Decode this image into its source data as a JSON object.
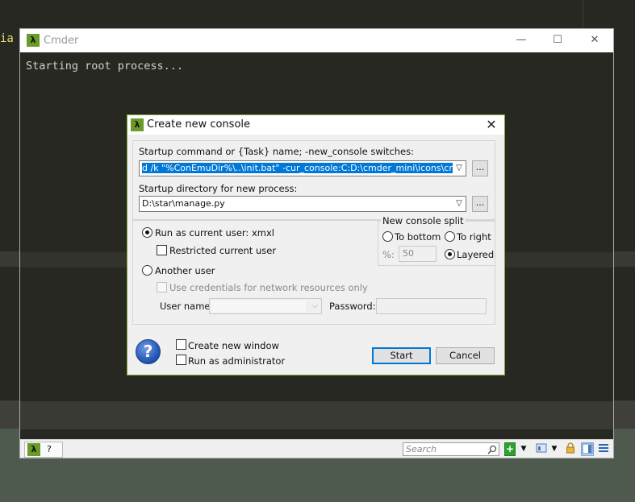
{
  "background": {
    "code_fragment": "ia"
  },
  "window": {
    "title": "Cmder",
    "minimize_glyph": "—",
    "maximize_glyph": "☐",
    "close_glyph": "✕"
  },
  "console": {
    "output": "Starting root process..."
  },
  "statusbar": {
    "tab_label": "?",
    "search_placeholder": "Search"
  },
  "dialog": {
    "title": "Create new console",
    "close_glyph": "✕",
    "startup_command_label": "Startup command or {Task} name; -new_console switches:",
    "startup_command_value": "d /k \"%ConEmuDir%\\..\\init.bat\" -cur_console:C:D:\\cmder_mini\\icons\\cmder.ico",
    "browse_label": "...",
    "startup_dir_label": "Startup directory for new process:",
    "startup_dir_value": "D:\\star\\manage.py",
    "run_as_current_user": "Run as current user: xmxl",
    "restricted_current_user": "Restricted current user",
    "another_user": "Another user",
    "use_credentials": "Use credentials for network resources only",
    "user_name_label": "User name:",
    "password_label": "Password:",
    "split_group_label": "New console split",
    "to_bottom": "To bottom",
    "to_right": "To right",
    "percent_label": "%:",
    "percent_value": "50",
    "layered": "Layered",
    "create_new_window": "Create new window",
    "run_as_admin": "Run as administrator",
    "help_glyph": "?",
    "start_button": "Start",
    "cancel_button": "Cancel"
  },
  "icons": {
    "lambda": "λ",
    "search": "search-icon",
    "add": "plus-icon",
    "lock": "lock-icon",
    "menu": "hamburger-icon"
  },
  "colors": {
    "cmder_accent": "#6a9a28",
    "console_bg": "#272822",
    "selection": "#0078d7"
  }
}
